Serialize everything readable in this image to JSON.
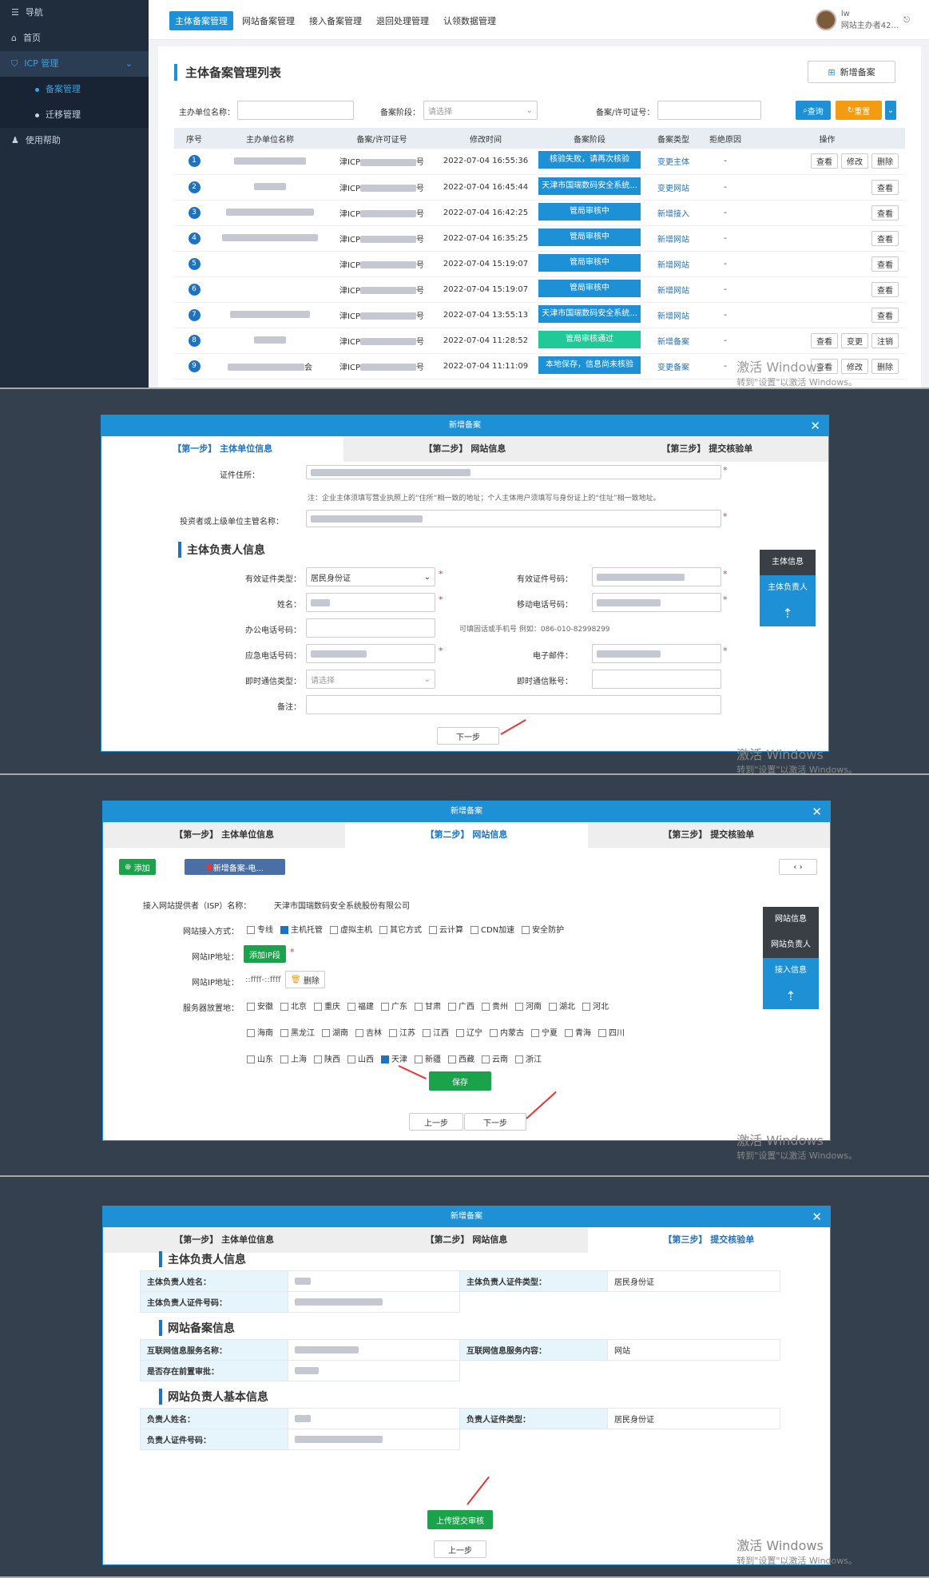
{
  "sidebar": {
    "nav": "导航",
    "home": "首页",
    "icp": "ICP 管理",
    "record": "备案管理",
    "migrate": "迁移管理",
    "help": "使用帮助"
  },
  "tabs": [
    "主体备案管理",
    "网站备案管理",
    "接入备案管理",
    "退回处理管理",
    "认领数据管理"
  ],
  "user": {
    "name": "lw",
    "role": "网站主办者42..."
  },
  "list": {
    "title": "主体备案管理列表",
    "new_btn": "新增备案",
    "f_unit": "主办单位名称：",
    "f_stage": "备案阶段：",
    "f_stage_ph": "请选择",
    "f_no": "备案/许可证号：",
    "search": "查询",
    "reset": "重置",
    "headers": [
      "序号",
      "主办单位名称",
      "备案/许可证号",
      "修改时间",
      "备案阶段",
      "备案类型",
      "拒绝原因",
      "操作"
    ],
    "rows": [
      {
        "n": "1",
        "lic": "津ICP",
        "lic_tail": "号",
        "time": "2022-07-04 16:55:36",
        "stage": "核验失败，请再次核验",
        "type": "变更主体",
        "ops": [
          "查看",
          "修改",
          "删除"
        ]
      },
      {
        "n": "2",
        "lic": "津ICP",
        "lic_tail": "号",
        "time": "2022-07-04 16:45:44",
        "stage": "天津市国瑞数码安全系统...",
        "type": "变更网站",
        "ops": [
          "查看"
        ]
      },
      {
        "n": "3",
        "lic": "津ICP",
        "lic_tail": "号",
        "time": "2022-07-04 16:42:25",
        "stage": "管局审核中",
        "type": "新增接入",
        "ops": [
          "查看"
        ]
      },
      {
        "n": "4",
        "lic": "津ICP",
        "lic_tail": "号",
        "time": "2022-07-04 16:35:25",
        "stage": "管局审核中",
        "type": "新增网站",
        "ops": [
          "查看"
        ]
      },
      {
        "n": "5",
        "lic": "津ICP",
        "lic_tail": "号",
        "time": "2022-07-04 15:19:07",
        "stage": "管局审核中",
        "type": "新增网站",
        "ops": [
          "查看"
        ]
      },
      {
        "n": "6",
        "lic": "津ICP",
        "lic_tail": "号",
        "time": "2022-07-04 15:19:07",
        "stage": "管局审核中",
        "type": "新增网站",
        "ops": [
          "查看"
        ]
      },
      {
        "n": "7",
        "lic": "津ICP",
        "lic_tail": "号",
        "time": "2022-07-04 13:55:13",
        "stage": "天津市国瑞数码安全系统...",
        "type": "新增网站",
        "ops": [
          "查看"
        ]
      },
      {
        "n": "8",
        "lic": "津ICP",
        "lic_tail": "号",
        "time": "2022-07-04 11:28:52",
        "stage": "管局审核通过",
        "type": "新增备案",
        "ops": [
          "查看",
          "变更",
          "注销"
        ]
      },
      {
        "n": "9",
        "lic": "津ICP",
        "lic_tail": "号",
        "time": "2022-07-04 11:11:09",
        "stage": "本地保存，信息尚未核验",
        "type": "变更备案",
        "ops": [
          "查看",
          "修改",
          "删除"
        ]
      }
    ],
    "dash": "-",
    "unit_tail": "会"
  },
  "watermark": {
    "l1": "激活 Windows",
    "l2": "转到\"设置\"以激活 Windows。"
  },
  "modal": {
    "title": "新增备案",
    "s1": "【第一步】 主体单位信息",
    "s2": "【第二步】 网站信息",
    "s3": "【第三步】 提交核验单"
  },
  "step1": {
    "addr": "证件住所：",
    "note": "注：企业主体须填写营业执照上的“住所”相一致的地址；个人主体用户须填写与身份证上的“住址”相一致地址。",
    "investor": "投资者或上级单位主管名称：",
    "sec": "主体负责人信息",
    "idtype": "有效证件类型：",
    "idtype_v": "居民身份证",
    "idno": "有效证件号码：",
    "name": "姓名：",
    "mobile": "移动电话号码：",
    "office": "办公电话号码：",
    "office_hint": "可填固话或手机号 例如：086-010-82998299",
    "emerg": "应急电话号码：",
    "email": "电子邮件：",
    "im": "即时通信类型：",
    "im_ph": "请选择",
    "imno": "即时通信账号：",
    "remark": "备注：",
    "next": "下一步",
    "nav": [
      "主体信息",
      "主体负责人"
    ]
  },
  "step2": {
    "add": "添加",
    "tab": "新增备案-电...",
    "isp_l": "接入网站提供者（ISP）名称：",
    "isp": "天津市国瑞数码安全系统股份有限公司",
    "method": "网站接入方式：",
    "methods": [
      "专线",
      "主机托管",
      "虚拟主机",
      "其它方式",
      "云计算",
      "CDN加速",
      "安全防护"
    ],
    "ip": "网站IP地址：",
    "add_ip": "添加IP段",
    "ip2": "网站IP地址：",
    "ip_v": "::ffff-::ffff",
    "del": "删除",
    "loc": "服务器放置地：",
    "p1": [
      "安徽",
      "北京",
      "重庆",
      "福建",
      "广东",
      "甘肃",
      "广西",
      "贵州",
      "河南",
      "湖北",
      "河北"
    ],
    "p2": [
      "海南",
      "黑龙江",
      "湖南",
      "吉林",
      "江苏",
      "江西",
      "辽宁",
      "内蒙古",
      "宁夏",
      "青海",
      "四川"
    ],
    "p3": [
      "山东",
      "上海",
      "陕西",
      "山西",
      "天津",
      "新疆",
      "西藏",
      "云南",
      "浙江"
    ],
    "save": "保存",
    "prev": "上一步",
    "next": "下一步",
    "nav": [
      "网站信息",
      "网站负责人",
      "接入信息"
    ]
  },
  "step3": {
    "sec1": "主体负责人信息",
    "k1": "主体负责人姓名：",
    "k2": "主体负责人证件类型：",
    "v2": "居民身份证",
    "k3": "主体负责人证件号码：",
    "sec2": "网站备案信息",
    "k4": "互联网信息服务名称：",
    "k5": "互联网信息服务内容：",
    "v5": "网站",
    "k6": "是否存在前置审批：",
    "sec3": "网站负责人基本信息",
    "k7": "负责人姓名：",
    "k8": "负责人证件类型：",
    "v8": "居民身份证",
    "k9": "负责人证件号码：",
    "submit": "上传提交审核",
    "prev": "上一步"
  }
}
